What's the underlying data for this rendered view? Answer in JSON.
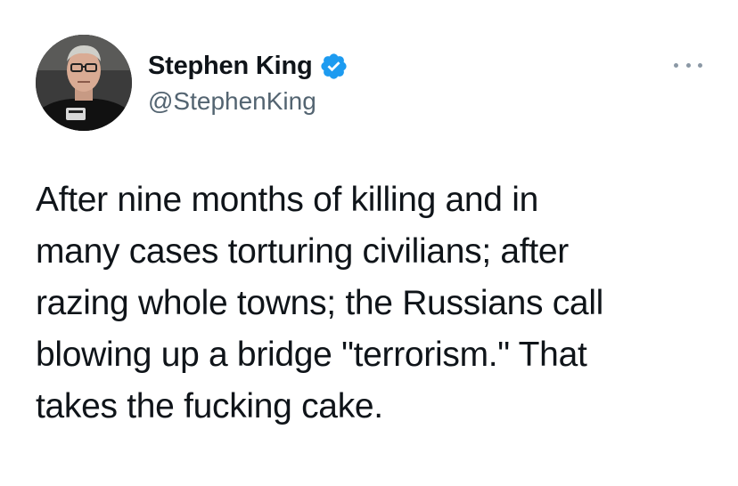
{
  "user": {
    "display_name": "Stephen King",
    "handle": "@StephenKing",
    "verified": true
  },
  "icons": {
    "verified": "verified-badge-icon",
    "more": "more-horizontal-icon"
  },
  "colors": {
    "verified_badge": "#1d9bf0",
    "text": "#0f1419",
    "secondary_text": "#536471",
    "link": "#1d9bf0"
  },
  "tweet": {
    "text": "After nine months of killing and in\nmany cases torturing civilians; after\nrazing whole towns; the Russians call\nblowing up a bridge \"terrorism.\" That\ntakes the fucking cake."
  }
}
